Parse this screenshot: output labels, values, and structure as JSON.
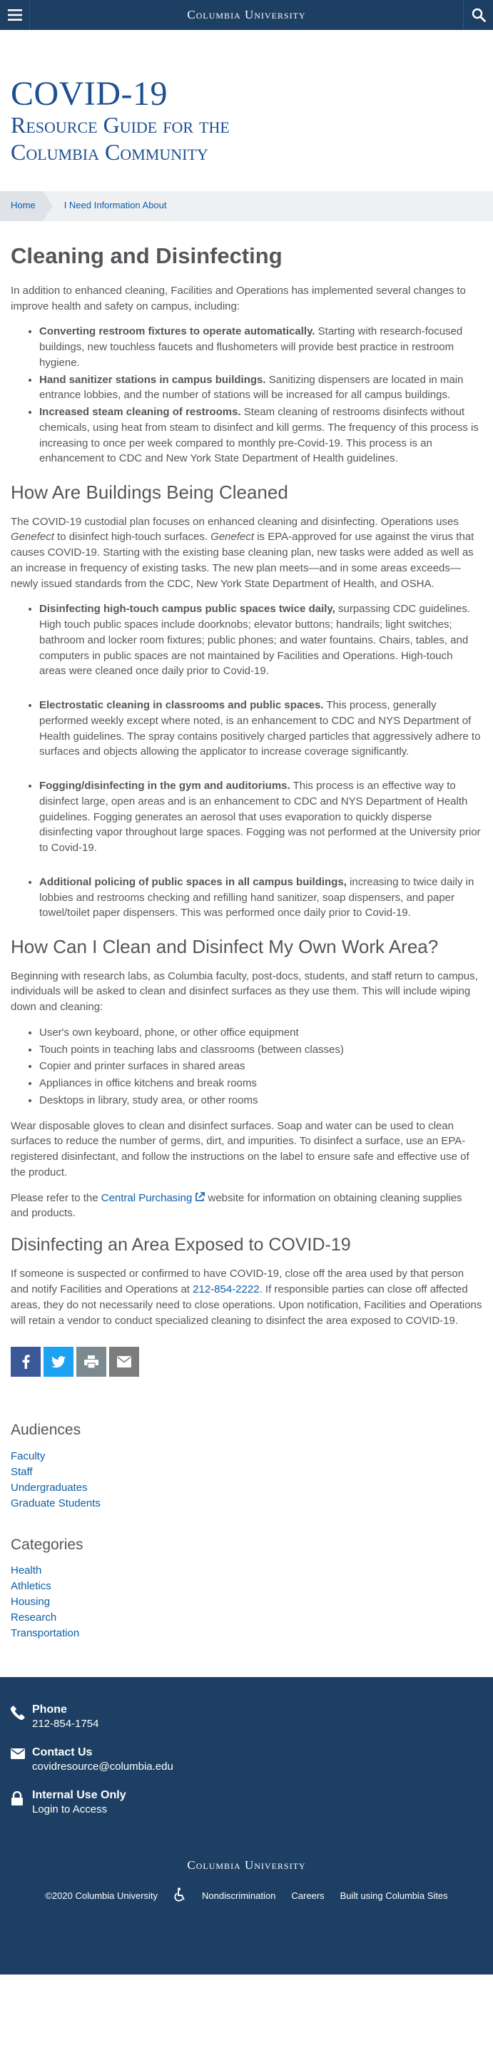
{
  "topbar": {
    "brand": "Columbia University",
    "menu_icon": "hamburger-menu-icon",
    "search_icon": "search-icon"
  },
  "hero": {
    "title_line1": "COVID-19",
    "title_line2": "Resource Guide for the",
    "title_line3": "Columbia Community"
  },
  "breadcrumb": {
    "home": "Home",
    "current": "I Need Information About"
  },
  "page_title": "Cleaning and Disinfecting",
  "intro": "In addition to enhanced cleaning, Facilities and Operations has implemented several changes to improve health and safety on campus, including:",
  "intro_list": [
    {
      "bold": "Converting restroom fixtures to operate automatically.",
      "text": " Starting with research-focused buildings, new touchless faucets and flushometers will provide best practice in restroom hygiene."
    },
    {
      "bold": "Hand sanitizer stations in campus buildings.",
      "text": " Sanitizing dispensers are located in main entrance lobbies, and the number of stations will be increased for all campus buildings."
    },
    {
      "bold": "Increased steam cleaning of restrooms.",
      "text": " Steam cleaning of restrooms disinfects without chemicals, using heat from steam to disinfect and kill germs. The frequency of this process is increasing to once per week compared to monthly pre-Covid-19. This process is an enhancement to CDC and New York State Department of Health guidelines."
    }
  ],
  "section1": {
    "heading": "How Are Buildings Being Cleaned",
    "p_part1": "The COVID-19 custodial plan focuses on enhanced cleaning and disinfecting. Operations uses ",
    "p_em1": "Genefect",
    "p_part2": " to disinfect high-touch surfaces. ",
    "p_em2": "Genefect",
    "p_part3": " is EPA-approved for use against the virus that causes COVID-19. Starting with the existing base cleaning plan, new tasks were added as well as an increase in frequency of existing tasks. The new plan meets—and in some areas exceeds—newly issued standards from the CDC, New York State Department of Health, and OSHA.",
    "list": [
      {
        "bold": "Disinfecting high-touch campus public spaces twice daily,",
        "text": " surpassing CDC guidelines. High touch public spaces include doorknobs; elevator buttons; handrails; light switches; bathroom and locker room fixtures; public phones; and water fountains. Chairs, tables, and computers in public spaces are not maintained by Facilities and Operations. High-touch areas were cleaned once daily prior to Covid-19."
      },
      {
        "bold": "Electrostatic cleaning in classrooms and public spaces.",
        "text": " This process, generally performed weekly except where noted, is an enhancement to CDC and NYS Department of Health guidelines. The spray contains positively charged particles that aggressively adhere to surfaces and objects allowing the applicator to increase coverage significantly."
      },
      {
        "bold": "Fogging/disinfecting in the gym and auditoriums.",
        "text": " This process is an effective way to disinfect large, open areas and is an enhancement to CDC and NYS Department of Health guidelines. Fogging generates an aerosol that uses evaporation to quickly disperse disinfecting vapor throughout large spaces. Fogging was not performed at the University prior to Covid-19."
      },
      {
        "bold": "Additional policing of public spaces in all campus buildings,",
        "text": " increasing to twice daily in lobbies and restrooms checking and refilling hand sanitizer, soap dispensers, and paper towel/toilet paper dispensers. This was performed once daily prior to Covid-19."
      }
    ]
  },
  "section2": {
    "heading": "How Can I Clean and Disinfect My Own Work Area?",
    "intro": "Beginning with research labs, as Columbia faculty, post-docs, students, and staff return to campus, individuals will be asked to clean and disinfect surfaces as they use them. This will include wiping down and cleaning:",
    "list": [
      "User's own keyboard, phone, or other office equipment",
      "Touch points in teaching labs and classrooms (between classes)",
      "Copier and printer surfaces in shared areas",
      "Appliances in office kitchens and break rooms",
      "Desktops in library, study area, or other rooms"
    ],
    "p2": "Wear disposable gloves to clean and disinfect surfaces. Soap and water can be used to clean surfaces to reduce the number of germs, dirt, and impurities. To disinfect a surface, use an EPA-registered disinfectant, and follow the instructions on the label to ensure safe and effective use of the product.",
    "p3_before": "Please refer to the ",
    "p3_link": "Central Purchasing",
    "p3_after": " website for information on obtaining cleaning supplies and products."
  },
  "section3": {
    "heading": "Disinfecting an Area Exposed to COVID-19",
    "p_before": "If someone is suspected or confirmed to have COVID-19, close off the area used by that person and notify Facilities and Operations at ",
    "p_phone": "212-854-2222",
    "p_after": ". If responsible parties can close off affected areas, they do not necessarily need to close operations. Upon notification, Facilities and Operations will retain a vendor to conduct specialized cleaning to disinfect the area exposed to COVID-19."
  },
  "share": {
    "icons": [
      "facebook-icon",
      "twitter-icon",
      "print-icon",
      "email-icon"
    ]
  },
  "audiences": {
    "heading": "Audiences",
    "items": [
      "Faculty",
      "Staff",
      "Undergraduates",
      "Graduate Students"
    ]
  },
  "categories": {
    "heading": "Categories",
    "items": [
      "Health",
      "Athletics",
      "Housing",
      "Research",
      "Transportation"
    ]
  },
  "footer": {
    "phone_title": "Phone",
    "phone_number": "212-854-1754",
    "contact_title": "Contact Us",
    "contact_email": "covidresource@columbia.edu",
    "internal_title": "Internal Use Only",
    "login_link": "Login",
    "login_suffix": " to Access",
    "brand": "Columbia University",
    "copyright": "©2020 Columbia University",
    "nondiscrimination": "Nondiscrimination",
    "careers": "Careers",
    "built": "Built using Columbia Sites"
  },
  "colors": {
    "navy": "#1d3f63",
    "heading_blue": "#1d4f91",
    "link_blue": "#0b5ea8",
    "text_gray": "#53565a",
    "facebook": "#3b5998",
    "twitter": "#1da1f2"
  }
}
